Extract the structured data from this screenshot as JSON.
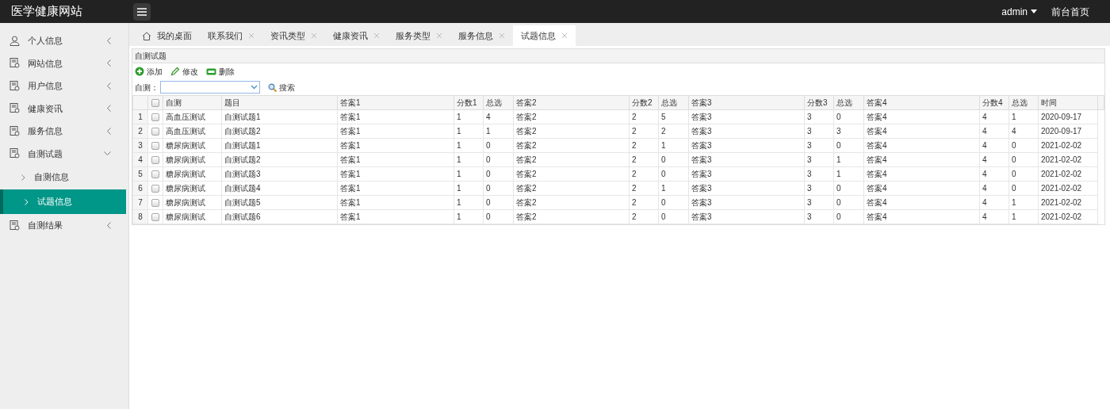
{
  "header": {
    "title": "医学健康网站",
    "user": "admin",
    "home_link": "前台首页"
  },
  "sidebar": {
    "items": [
      {
        "label": "个人信息",
        "kind": "person",
        "expanded": false
      },
      {
        "label": "网站信息",
        "kind": "doc",
        "expanded": false
      },
      {
        "label": "用户信息",
        "kind": "doc",
        "expanded": false
      },
      {
        "label": "健康资讯",
        "kind": "doc",
        "expanded": false
      },
      {
        "label": "服务信息",
        "kind": "doc",
        "expanded": false
      },
      {
        "label": "自测试题",
        "kind": "doc",
        "expanded": true,
        "children": [
          {
            "label": "自测信息",
            "selected": false
          },
          {
            "label": "试题信息",
            "selected": true
          }
        ]
      },
      {
        "label": "自测结果",
        "kind": "doc",
        "expanded": false
      }
    ]
  },
  "tabs": [
    {
      "label": "我的桌面",
      "kind": "home",
      "selected": false
    },
    {
      "label": "联系我们",
      "kind": "closable",
      "selected": false
    },
    {
      "label": "资讯类型",
      "kind": "closable",
      "selected": false
    },
    {
      "label": "健康资讯",
      "kind": "closable",
      "selected": false
    },
    {
      "label": "服务类型",
      "kind": "closable",
      "selected": false
    },
    {
      "label": "服务信息",
      "kind": "closable",
      "selected": false
    },
    {
      "label": "试题信息",
      "kind": "closable",
      "selected": true
    }
  ],
  "panel": {
    "title": "自测试题",
    "toolbar": [
      {
        "label": "添加",
        "kind": "add"
      },
      {
        "label": "修改",
        "kind": "edit"
      },
      {
        "label": "删除",
        "kind": "delete"
      }
    ],
    "filter": {
      "label": "自测：",
      "search": "搜索"
    },
    "table": {
      "columns": [
        "自测",
        "题目",
        "答案1",
        "分数1",
        "总选",
        "答案2",
        "分数2",
        "总选",
        "答案3",
        "分数3",
        "总选",
        "答案4",
        "分数4",
        "总选",
        "时间"
      ],
      "header_checked": false,
      "rows": [
        {
          "number": "1",
          "checked": false,
          "cells": [
            "高血压测试",
            "自测试题1",
            "答案1",
            "1",
            "4",
            "答案2",
            "2",
            "5",
            "答案3",
            "3",
            "0",
            "答案4",
            "4",
            "1",
            "2020-09-17"
          ]
        },
        {
          "number": "2",
          "checked": false,
          "cells": [
            "高血压测试",
            "自测试题2",
            "答案1",
            "1",
            "1",
            "答案2",
            "2",
            "2",
            "答案3",
            "3",
            "3",
            "答案4",
            "4",
            "4",
            "2020-09-17"
          ]
        },
        {
          "number": "3",
          "checked": false,
          "cells": [
            "糖尿病测试",
            "自测试题1",
            "答案1",
            "1",
            "0",
            "答案2",
            "2",
            "1",
            "答案3",
            "3",
            "0",
            "答案4",
            "4",
            "0",
            "2021-02-02"
          ]
        },
        {
          "number": "4",
          "checked": false,
          "cells": [
            "糖尿病测试",
            "自测试题2",
            "答案1",
            "1",
            "0",
            "答案2",
            "2",
            "0",
            "答案3",
            "3",
            "1",
            "答案4",
            "4",
            "0",
            "2021-02-02"
          ]
        },
        {
          "number": "5",
          "checked": false,
          "cells": [
            "糖尿病测试",
            "自测试题3",
            "答案1",
            "1",
            "0",
            "答案2",
            "2",
            "0",
            "答案3",
            "3",
            "1",
            "答案4",
            "4",
            "0",
            "2021-02-02"
          ]
        },
        {
          "number": "6",
          "checked": false,
          "cells": [
            "糖尿病测试",
            "自测试题4",
            "答案1",
            "1",
            "0",
            "答案2",
            "2",
            "1",
            "答案3",
            "3",
            "0",
            "答案4",
            "4",
            "0",
            "2021-02-02"
          ]
        },
        {
          "number": "7",
          "checked": false,
          "cells": [
            "糖尿病测试",
            "自测试题5",
            "答案1",
            "1",
            "0",
            "答案2",
            "2",
            "0",
            "答案3",
            "3",
            "0",
            "答案4",
            "4",
            "1",
            "2021-02-02"
          ]
        },
        {
          "number": "8",
          "checked": false,
          "cells": [
            "糖尿病测试",
            "自测试题6",
            "答案1",
            "1",
            "0",
            "答案2",
            "2",
            "0",
            "答案3",
            "3",
            "0",
            "答案4",
            "4",
            "1",
            "2021-02-02"
          ]
        }
      ]
    }
  }
}
